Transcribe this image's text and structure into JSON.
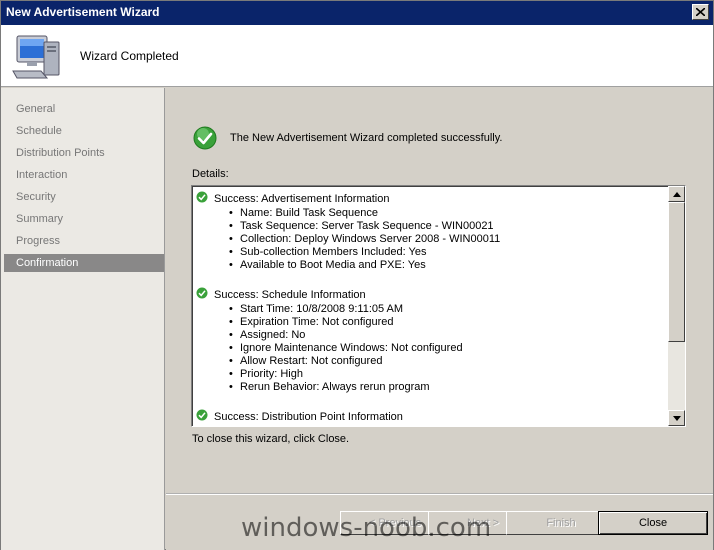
{
  "window": {
    "title": "New Advertisement Wizard"
  },
  "header": {
    "title": "Wizard Completed"
  },
  "nav": {
    "items": [
      {
        "label": "General"
      },
      {
        "label": "Schedule"
      },
      {
        "label": "Distribution Points"
      },
      {
        "label": "Interaction"
      },
      {
        "label": "Security"
      },
      {
        "label": "Summary"
      },
      {
        "label": "Progress"
      },
      {
        "label": "Confirmation",
        "active": true
      }
    ]
  },
  "content": {
    "status_text": "The New Advertisement Wizard completed successfully.",
    "details_label": "Details:",
    "close_hint": "To close this wizard, click Close.",
    "sections": [
      {
        "heading": "Success: Advertisement Information",
        "items": [
          "Name: Build Task Sequence",
          "Task Sequence: Server Task Sequence - WIN00021",
          "Collection: Deploy Windows Server 2008 - WIN00011",
          "Sub-collection Members Included: Yes",
          "Available to Boot Media and PXE: Yes"
        ]
      },
      {
        "heading": "Success: Schedule Information",
        "items": [
          "Start Time: 10/8/2008 9:11:05 AM",
          "Expiration Time: Not configured",
          "Assigned: No",
          "Ignore Maintenance Windows: Not configured",
          "Allow Restart: Not configured",
          "Priority: High",
          "Rerun Behavior: Always rerun program"
        ]
      },
      {
        "heading": "Success: Distribution Point Information",
        "items": []
      }
    ]
  },
  "footer": {
    "previous_label": "< Previous",
    "next_label": "Next >",
    "finish_label": "Finish",
    "close_label": "Close"
  },
  "watermark": "windows-noob.com",
  "icons": {
    "computer": "computer-icon",
    "success": "success-check-icon",
    "close": "close-icon"
  },
  "colors": {
    "titlebar": "#0a246a",
    "nav_active": "#898888",
    "success_green": "#3aa13a"
  }
}
